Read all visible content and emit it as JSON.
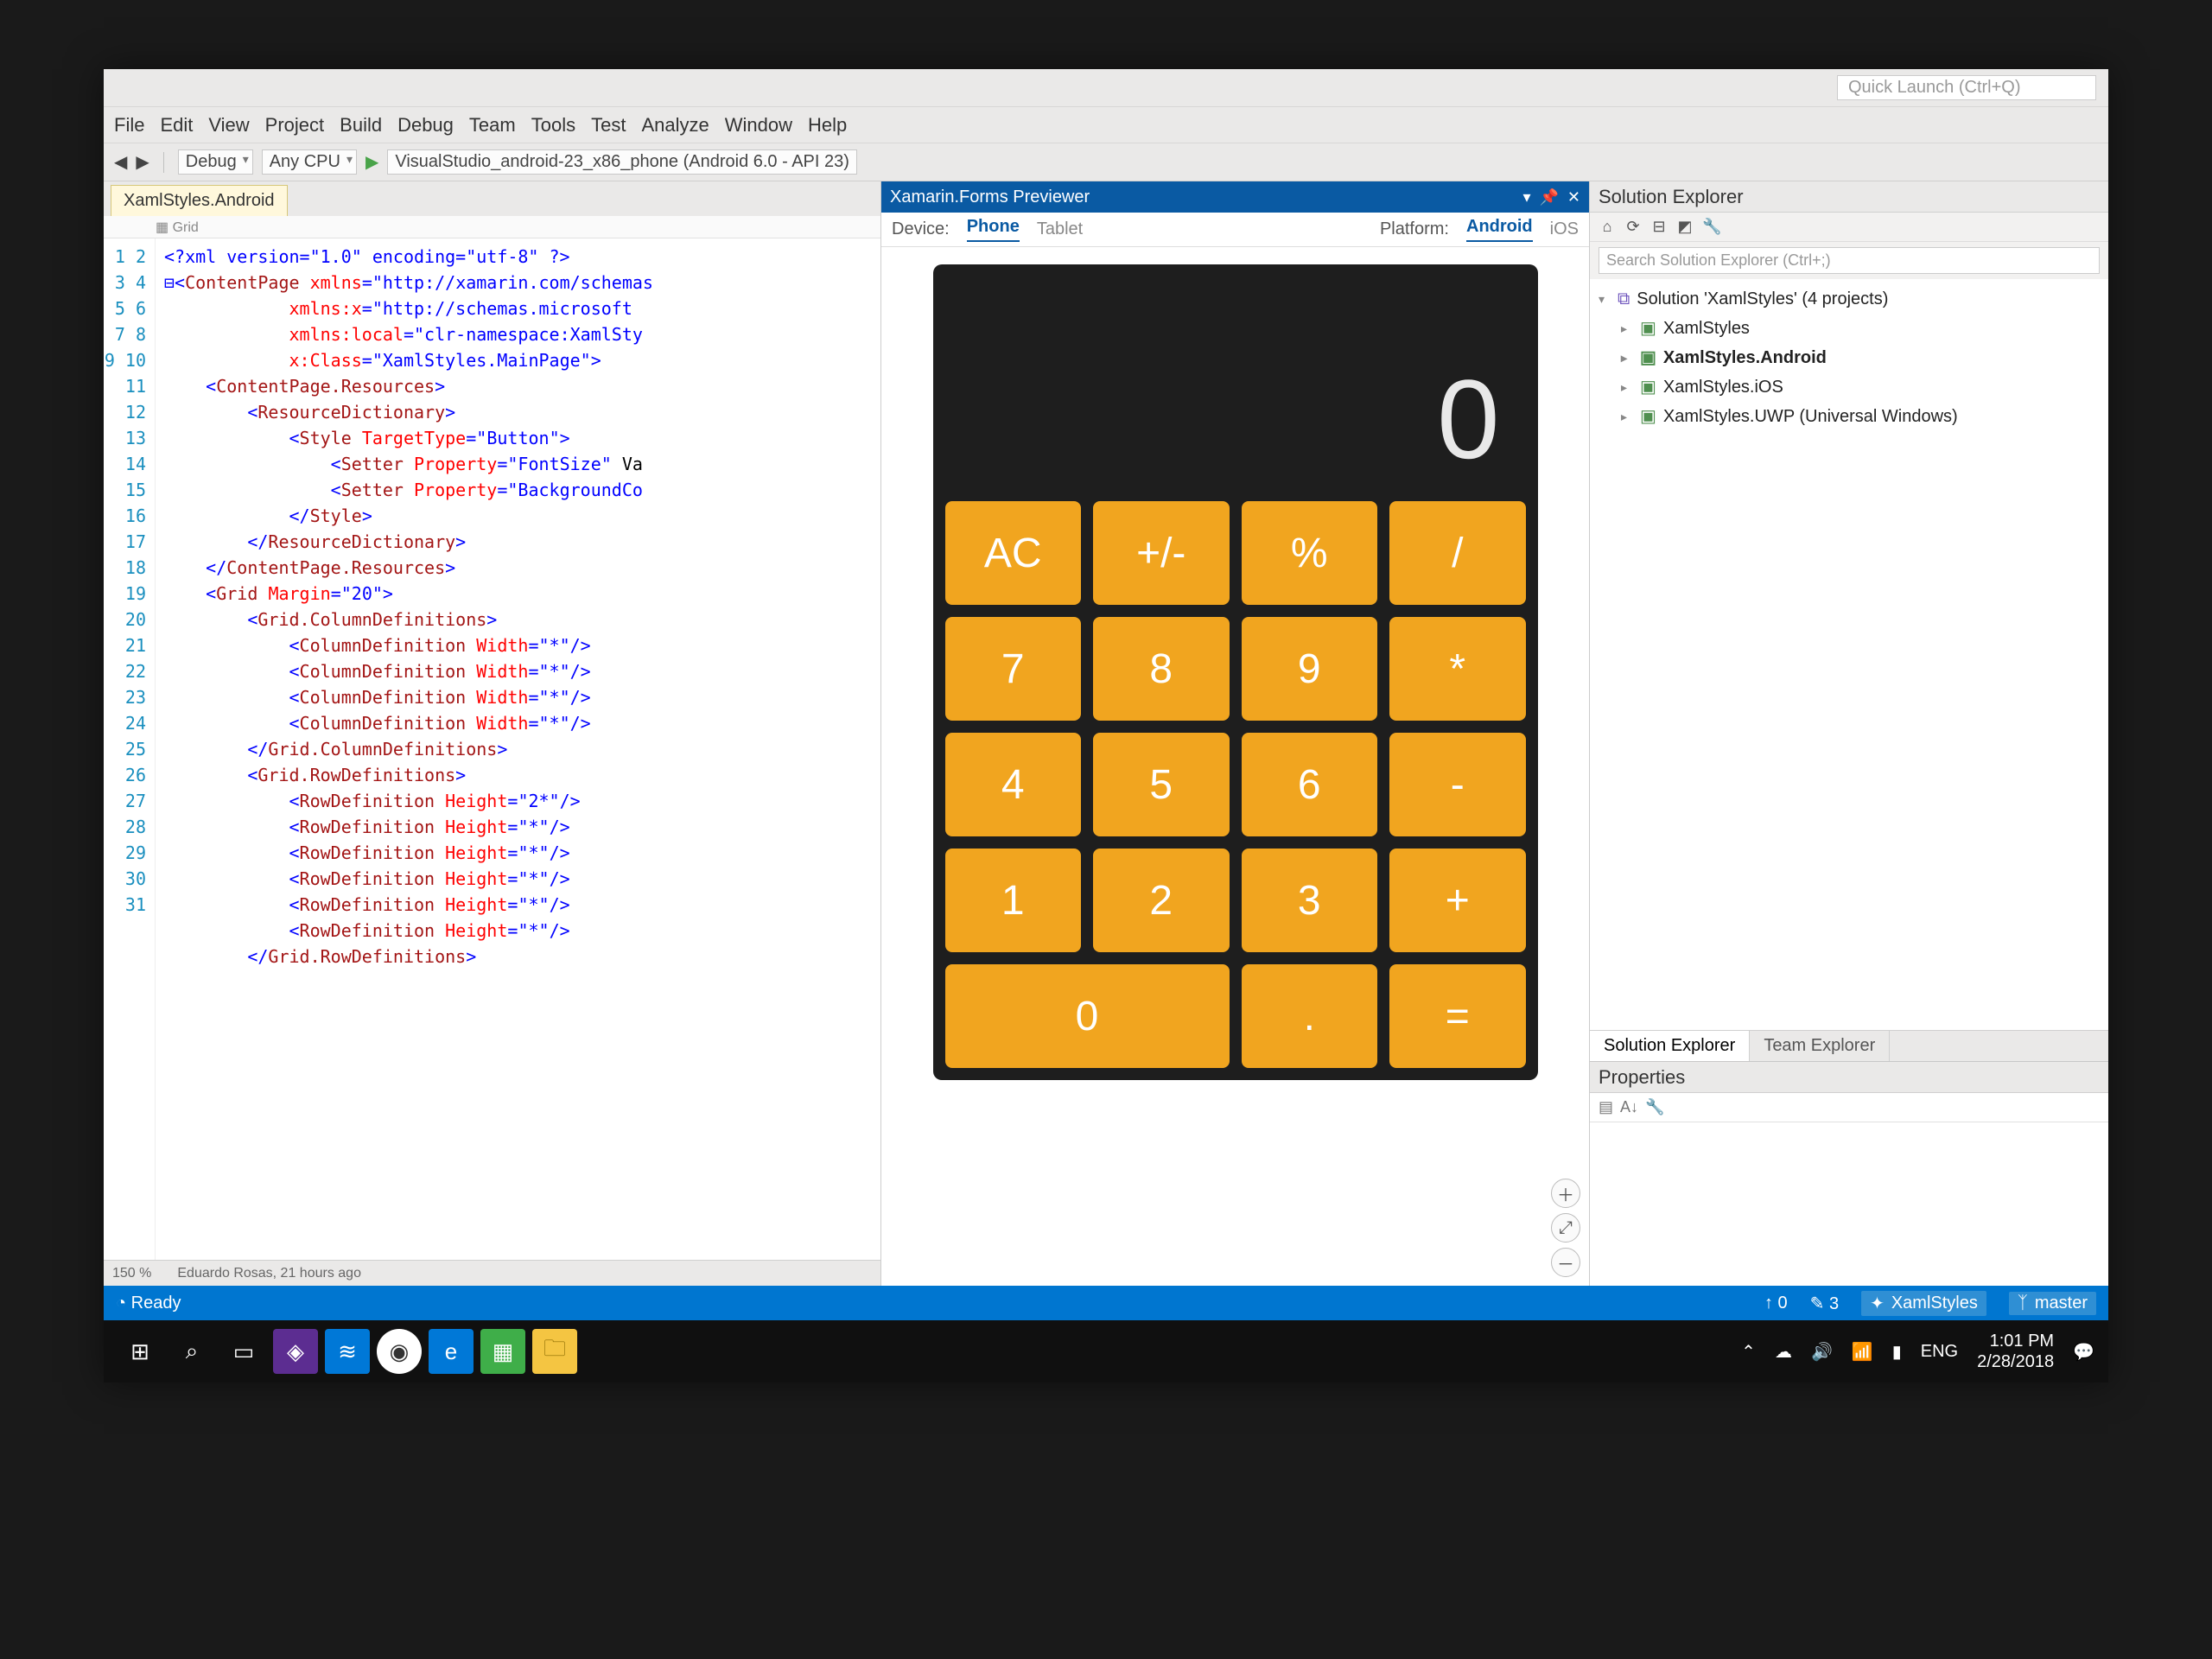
{
  "titlebar": {
    "quick_launch_placeholder": "Quick Launch (Ctrl+Q)"
  },
  "menu": {
    "items": [
      "File",
      "Edit",
      "View",
      "Project",
      "Build",
      "Debug",
      "Team",
      "Tools",
      "Test",
      "Analyze",
      "Window",
      "Help"
    ]
  },
  "toolbar": {
    "config": "Debug",
    "platform": "Any CPU",
    "run_target": "VisualStudio_android-23_x86_phone (Android 6.0 - API 23)"
  },
  "editor": {
    "tab_label": "XamlStyles.Android",
    "ruler_label": "Grid",
    "zoom": "150 %",
    "footer": "Eduardo Rosas, 21 hours ago",
    "line_numbers": [
      "1",
      "2",
      "3",
      "4",
      "5",
      "6",
      "7",
      "8",
      "9",
      "10",
      "11",
      "12",
      "13",
      "14",
      "15",
      "16",
      "17",
      "18",
      "19",
      "20",
      "21",
      "22",
      "23",
      "24",
      "25",
      "26",
      "27",
      "28",
      "29",
      "30",
      "31"
    ],
    "code_lines": [
      {
        "indent": 0,
        "parts": [
          {
            "c": "t-pi",
            "t": "<?xml version=\"1.0\" encoding=\"utf-8\" ?>"
          }
        ]
      },
      {
        "indent": 0,
        "parts": [
          {
            "c": "t-punc",
            "t": "⊟<"
          },
          {
            "c": "t-el",
            "t": "ContentPage"
          },
          {
            "c": "",
            "t": " "
          },
          {
            "c": "t-attr",
            "t": "xmlns"
          },
          {
            "c": "t-punc",
            "t": "="
          },
          {
            "c": "t-str",
            "t": "\"http://xamarin.com/schemas"
          }
        ]
      },
      {
        "indent": 3,
        "parts": [
          {
            "c": "t-attr",
            "t": "xmlns:x"
          },
          {
            "c": "t-punc",
            "t": "="
          },
          {
            "c": "t-str",
            "t": "\"http://schemas.microsoft"
          }
        ]
      },
      {
        "indent": 3,
        "parts": [
          {
            "c": "t-attr",
            "t": "xmlns:local"
          },
          {
            "c": "t-punc",
            "t": "="
          },
          {
            "c": "t-str",
            "t": "\"clr-namespace:XamlSty"
          }
        ]
      },
      {
        "indent": 3,
        "parts": [
          {
            "c": "t-attr",
            "t": "x:Class"
          },
          {
            "c": "t-punc",
            "t": "="
          },
          {
            "c": "t-str",
            "t": "\"XamlStyles.MainPage\""
          },
          {
            "c": "t-punc",
            "t": ">"
          }
        ]
      },
      {
        "indent": 0,
        "parts": [
          {
            "c": "",
            "t": ""
          }
        ]
      },
      {
        "indent": 1,
        "parts": [
          {
            "c": "t-punc",
            "t": "<"
          },
          {
            "c": "t-el",
            "t": "ContentPage.Resources"
          },
          {
            "c": "t-punc",
            "t": ">"
          }
        ]
      },
      {
        "indent": 2,
        "parts": [
          {
            "c": "t-punc",
            "t": "<"
          },
          {
            "c": "t-el",
            "t": "ResourceDictionary"
          },
          {
            "c": "t-punc",
            "t": ">"
          }
        ]
      },
      {
        "indent": 3,
        "parts": [
          {
            "c": "t-punc",
            "t": "<"
          },
          {
            "c": "t-el",
            "t": "Style"
          },
          {
            "c": "",
            "t": " "
          },
          {
            "c": "t-attr",
            "t": "TargetType"
          },
          {
            "c": "t-punc",
            "t": "="
          },
          {
            "c": "t-str",
            "t": "\"Button\""
          },
          {
            "c": "t-punc",
            "t": ">"
          }
        ]
      },
      {
        "indent": 4,
        "parts": [
          {
            "c": "t-punc",
            "t": "<"
          },
          {
            "c": "t-el",
            "t": "Setter"
          },
          {
            "c": "",
            "t": " "
          },
          {
            "c": "t-attr",
            "t": "Property"
          },
          {
            "c": "t-punc",
            "t": "="
          },
          {
            "c": "t-str",
            "t": "\"FontSize\""
          },
          {
            "c": "",
            "t": " Va"
          }
        ]
      },
      {
        "indent": 4,
        "parts": [
          {
            "c": "t-punc",
            "t": "<"
          },
          {
            "c": "t-el",
            "t": "Setter"
          },
          {
            "c": "",
            "t": " "
          },
          {
            "c": "t-attr",
            "t": "Property"
          },
          {
            "c": "t-punc",
            "t": "="
          },
          {
            "c": "t-str",
            "t": "\"BackgroundCo"
          }
        ]
      },
      {
        "indent": 3,
        "parts": [
          {
            "c": "t-punc",
            "t": "</"
          },
          {
            "c": "t-el",
            "t": "Style"
          },
          {
            "c": "t-punc",
            "t": ">"
          }
        ]
      },
      {
        "indent": 2,
        "parts": [
          {
            "c": "t-punc",
            "t": "</"
          },
          {
            "c": "t-el",
            "t": "ResourceDictionary"
          },
          {
            "c": "t-punc",
            "t": ">"
          }
        ]
      },
      {
        "indent": 1,
        "parts": [
          {
            "c": "t-punc",
            "t": "</"
          },
          {
            "c": "t-el",
            "t": "ContentPage.Resources"
          },
          {
            "c": "t-punc",
            "t": ">"
          }
        ]
      },
      {
        "indent": 0,
        "parts": [
          {
            "c": "",
            "t": ""
          }
        ]
      },
      {
        "indent": 1,
        "parts": [
          {
            "c": "t-punc",
            "t": "<"
          },
          {
            "c": "t-el",
            "t": "Grid"
          },
          {
            "c": "",
            "t": " "
          },
          {
            "c": "t-attr",
            "t": "Margin"
          },
          {
            "c": "t-punc",
            "t": "="
          },
          {
            "c": "t-str",
            "t": "\"20\""
          },
          {
            "c": "t-punc",
            "t": ">"
          }
        ]
      },
      {
        "indent": 2,
        "parts": [
          {
            "c": "t-punc",
            "t": "<"
          },
          {
            "c": "t-el",
            "t": "Grid.ColumnDefinitions"
          },
          {
            "c": "t-punc",
            "t": ">"
          }
        ]
      },
      {
        "indent": 3,
        "parts": [
          {
            "c": "t-punc",
            "t": "<"
          },
          {
            "c": "t-el",
            "t": "ColumnDefinition"
          },
          {
            "c": "",
            "t": " "
          },
          {
            "c": "t-attr",
            "t": "Width"
          },
          {
            "c": "t-punc",
            "t": "="
          },
          {
            "c": "t-str",
            "t": "\"*\""
          },
          {
            "c": "t-punc",
            "t": "/>"
          }
        ]
      },
      {
        "indent": 3,
        "parts": [
          {
            "c": "t-punc",
            "t": "<"
          },
          {
            "c": "t-el",
            "t": "ColumnDefinition"
          },
          {
            "c": "",
            "t": " "
          },
          {
            "c": "t-attr",
            "t": "Width"
          },
          {
            "c": "t-punc",
            "t": "="
          },
          {
            "c": "t-str",
            "t": "\"*\""
          },
          {
            "c": "t-punc",
            "t": "/>"
          }
        ]
      },
      {
        "indent": 3,
        "parts": [
          {
            "c": "t-punc",
            "t": "<"
          },
          {
            "c": "t-el",
            "t": "ColumnDefinition"
          },
          {
            "c": "",
            "t": " "
          },
          {
            "c": "t-attr",
            "t": "Width"
          },
          {
            "c": "t-punc",
            "t": "="
          },
          {
            "c": "t-str",
            "t": "\"*\""
          },
          {
            "c": "t-punc",
            "t": "/>"
          }
        ]
      },
      {
        "indent": 3,
        "parts": [
          {
            "c": "t-punc",
            "t": "<"
          },
          {
            "c": "t-el",
            "t": "ColumnDefinition"
          },
          {
            "c": "",
            "t": " "
          },
          {
            "c": "t-attr",
            "t": "Width"
          },
          {
            "c": "t-punc",
            "t": "="
          },
          {
            "c": "t-str",
            "t": "\"*\""
          },
          {
            "c": "t-punc",
            "t": "/>"
          }
        ]
      },
      {
        "indent": 2,
        "parts": [
          {
            "c": "t-punc",
            "t": "</"
          },
          {
            "c": "t-el",
            "t": "Grid.ColumnDefinitions"
          },
          {
            "c": "t-punc",
            "t": ">"
          }
        ]
      },
      {
        "indent": 2,
        "parts": [
          {
            "c": "t-punc",
            "t": "<"
          },
          {
            "c": "t-el",
            "t": "Grid.RowDefinitions"
          },
          {
            "c": "t-punc",
            "t": ">"
          }
        ]
      },
      {
        "indent": 3,
        "parts": [
          {
            "c": "t-punc",
            "t": "<"
          },
          {
            "c": "t-el",
            "t": "RowDefinition"
          },
          {
            "c": "",
            "t": " "
          },
          {
            "c": "t-attr",
            "t": "Height"
          },
          {
            "c": "t-punc",
            "t": "="
          },
          {
            "c": "t-str",
            "t": "\"2*\""
          },
          {
            "c": "t-punc",
            "t": "/>"
          }
        ]
      },
      {
        "indent": 3,
        "parts": [
          {
            "c": "t-punc",
            "t": "<"
          },
          {
            "c": "t-el",
            "t": "RowDefinition"
          },
          {
            "c": "",
            "t": " "
          },
          {
            "c": "t-attr",
            "t": "Height"
          },
          {
            "c": "t-punc",
            "t": "="
          },
          {
            "c": "t-str",
            "t": "\"*\""
          },
          {
            "c": "t-punc",
            "t": "/>"
          }
        ]
      },
      {
        "indent": 3,
        "parts": [
          {
            "c": "t-punc",
            "t": "<"
          },
          {
            "c": "t-el",
            "t": "RowDefinition"
          },
          {
            "c": "",
            "t": " "
          },
          {
            "c": "t-attr",
            "t": "Height"
          },
          {
            "c": "t-punc",
            "t": "="
          },
          {
            "c": "t-str",
            "t": "\"*\""
          },
          {
            "c": "t-punc",
            "t": "/>"
          }
        ]
      },
      {
        "indent": 3,
        "parts": [
          {
            "c": "t-punc",
            "t": "<"
          },
          {
            "c": "t-el",
            "t": "RowDefinition"
          },
          {
            "c": "",
            "t": " "
          },
          {
            "c": "t-attr",
            "t": "Height"
          },
          {
            "c": "t-punc",
            "t": "="
          },
          {
            "c": "t-str",
            "t": "\"*\""
          },
          {
            "c": "t-punc",
            "t": "/>"
          }
        ]
      },
      {
        "indent": 3,
        "parts": [
          {
            "c": "t-punc",
            "t": "<"
          },
          {
            "c": "t-el",
            "t": "RowDefinition"
          },
          {
            "c": "",
            "t": " "
          },
          {
            "c": "t-attr",
            "t": "Height"
          },
          {
            "c": "t-punc",
            "t": "="
          },
          {
            "c": "t-str",
            "t": "\"*\""
          },
          {
            "c": "t-punc",
            "t": "/>"
          }
        ]
      },
      {
        "indent": 3,
        "parts": [
          {
            "c": "t-punc",
            "t": "<"
          },
          {
            "c": "t-el",
            "t": "RowDefinition"
          },
          {
            "c": "",
            "t": " "
          },
          {
            "c": "t-attr",
            "t": "Height"
          },
          {
            "c": "t-punc",
            "t": "="
          },
          {
            "c": "t-str",
            "t": "\"*\""
          },
          {
            "c": "t-punc",
            "t": "/>"
          }
        ]
      },
      {
        "indent": 2,
        "parts": [
          {
            "c": "t-punc",
            "t": "</"
          },
          {
            "c": "t-el",
            "t": "Grid.RowDefinitions"
          },
          {
            "c": "t-punc",
            "t": ">"
          }
        ]
      },
      {
        "indent": 0,
        "parts": [
          {
            "c": "",
            "t": ""
          }
        ]
      }
    ]
  },
  "previewer": {
    "title": "Xamarin.Forms Previewer",
    "device_label": "Device:",
    "device_options": [
      "Phone",
      "Tablet"
    ],
    "device_selected": "Phone",
    "platform_label": "Platform:",
    "platform_options": [
      "Android",
      "iOS"
    ],
    "platform_selected": "Android",
    "calc_display": "0",
    "buttons": [
      {
        "label": "AC",
        "wide": false
      },
      {
        "label": "+/-",
        "wide": false
      },
      {
        "label": "%",
        "wide": false
      },
      {
        "label": "/",
        "wide": false
      },
      {
        "label": "7",
        "wide": false
      },
      {
        "label": "8",
        "wide": false
      },
      {
        "label": "9",
        "wide": false
      },
      {
        "label": "*",
        "wide": false
      },
      {
        "label": "4",
        "wide": false
      },
      {
        "label": "5",
        "wide": false
      },
      {
        "label": "6",
        "wide": false
      },
      {
        "label": "-",
        "wide": false
      },
      {
        "label": "1",
        "wide": false
      },
      {
        "label": "2",
        "wide": false
      },
      {
        "label": "3",
        "wide": false
      },
      {
        "label": "+",
        "wide": false
      },
      {
        "label": "0",
        "wide": true
      },
      {
        "label": ".",
        "wide": false
      },
      {
        "label": "=",
        "wide": false
      }
    ]
  },
  "solution_explorer": {
    "title": "Solution Explorer",
    "search_placeholder": "Search Solution Explorer (Ctrl+;)",
    "nodes": [
      {
        "level": 1,
        "exp": "▾",
        "icon": "ico-sln",
        "label": "Solution 'XamlStyles' (4 projects)",
        "bold": false
      },
      {
        "level": 2,
        "exp": "▸",
        "icon": "ico-proj",
        "label": "XamlStyles",
        "bold": false
      },
      {
        "level": 2,
        "exp": "▸",
        "icon": "ico-proj",
        "label": "XamlStyles.Android",
        "bold": true
      },
      {
        "level": 2,
        "exp": "▸",
        "icon": "ico-proj",
        "label": "XamlStyles.iOS",
        "bold": false
      },
      {
        "level": 2,
        "exp": "▸",
        "icon": "ico-proj",
        "label": "XamlStyles.UWP (Universal Windows)",
        "bold": false
      }
    ],
    "tabs": [
      "Solution Explorer",
      "Team Explorer"
    ]
  },
  "properties": {
    "title": "Properties"
  },
  "vs_status": {
    "left": "Ready",
    "uploads": "0",
    "edits": "3",
    "repo": "XamlStyles",
    "branch": "master"
  },
  "taskbar": {
    "lang": "ENG",
    "time": "1:01 PM",
    "date": "2/28/2018"
  }
}
